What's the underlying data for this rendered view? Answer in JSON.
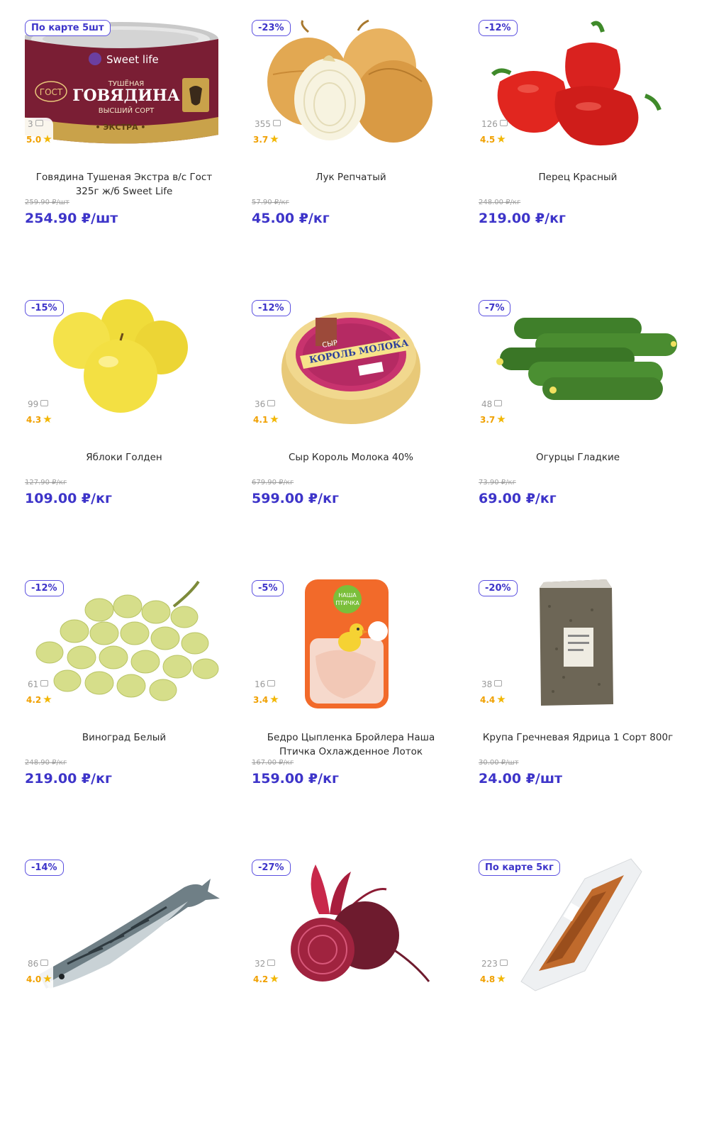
{
  "colors": {
    "accent": "#3d34c9",
    "badge_border": "#5a4fe0",
    "star": "#f2b705",
    "old_price": "#9e9e9e"
  },
  "products": [
    {
      "badge": "По карте 5шт",
      "reviews": "3",
      "rating": "5.0",
      "name": "Говядина Тушеная Экстра в/с Гост 325г ж/б Sweet Life",
      "old_price": "259.90 ₽/шт",
      "price": "254.90 ₽/шт",
      "image": "canned-beef-image",
      "label": {
        "brand": "Sweet life",
        "gost": "ГОСТ",
        "top": "ТУШЁНАЯ",
        "main": "ГОВЯДИНА",
        "grade": "ВЫСШИЙ СОРТ",
        "extra": "• ЭКСТРА •"
      }
    },
    {
      "badge": "-23%",
      "reviews": "355",
      "rating": "3.7",
      "name": "Лук Репчатый",
      "old_price": "57.90 ₽/кг",
      "price": "45.00 ₽/кг",
      "image": "onion-image"
    },
    {
      "badge": "-12%",
      "reviews": "126",
      "rating": "4.5",
      "name": "Перец Красный",
      "old_price": "248.00 ₽/кг",
      "price": "219.00 ₽/кг",
      "image": "red-pepper-image"
    },
    {
      "badge": "-15%",
      "reviews": "99",
      "rating": "4.3",
      "name": "Яблоки Голден",
      "old_price": "127.90 ₽/кг",
      "price": "109.00 ₽/кг",
      "image": "apples-image"
    },
    {
      "badge": "-12%",
      "reviews": "36",
      "rating": "4.1",
      "name": "Сыр Король Молока 40%",
      "old_price": "679.90 ₽/кг",
      "price": "599.00 ₽/кг",
      "image": "cheese-image",
      "label": {
        "cheese": "СЫР",
        "brand": "КОРОЛЬ МОЛОКА"
      }
    },
    {
      "badge": "-7%",
      "reviews": "48",
      "rating": "3.7",
      "name": "Огурцы Гладкие",
      "old_price": "73.90 ₽/кг",
      "price": "69.00 ₽/кг",
      "image": "cucumbers-image"
    },
    {
      "badge": "-12%",
      "reviews": "61",
      "rating": "4.2",
      "name": "Виноград Белый",
      "old_price": "248.90 ₽/кг",
      "price": "219.00 ₽/кг",
      "image": "grapes-image"
    },
    {
      "badge": "-5%",
      "reviews": "16",
      "rating": "3.4",
      "name": "Бедро Цыпленка Бройлера Наша Птичка Охлажденное Лоток",
      "old_price": "167.00 ₽/кг",
      "price": "159.00 ₽/кг",
      "image": "chicken-tray-image",
      "label": {
        "l1": "НАША",
        "l2": "ПТИЧКА"
      }
    },
    {
      "badge": "-20%",
      "reviews": "38",
      "rating": "4.4",
      "name": "Крупа Гречневая Ядрица 1 Сорт 800г",
      "old_price": "30.00 ₽/шт",
      "price": "24.00 ₽/шт",
      "image": "buckwheat-bag-image"
    },
    {
      "badge": "-14%",
      "reviews": "86",
      "rating": "4.0",
      "name": "",
      "old_price": "",
      "price": "",
      "image": "mackerel-image"
    },
    {
      "badge": "-27%",
      "reviews": "32",
      "rating": "4.2",
      "name": "",
      "old_price": "",
      "price": "",
      "image": "beetroot-image"
    },
    {
      "badge": "По карте 5кг",
      "reviews": "223",
      "rating": "4.8",
      "name": "",
      "old_price": "",
      "price": "",
      "image": "smoked-fish-image"
    }
  ]
}
